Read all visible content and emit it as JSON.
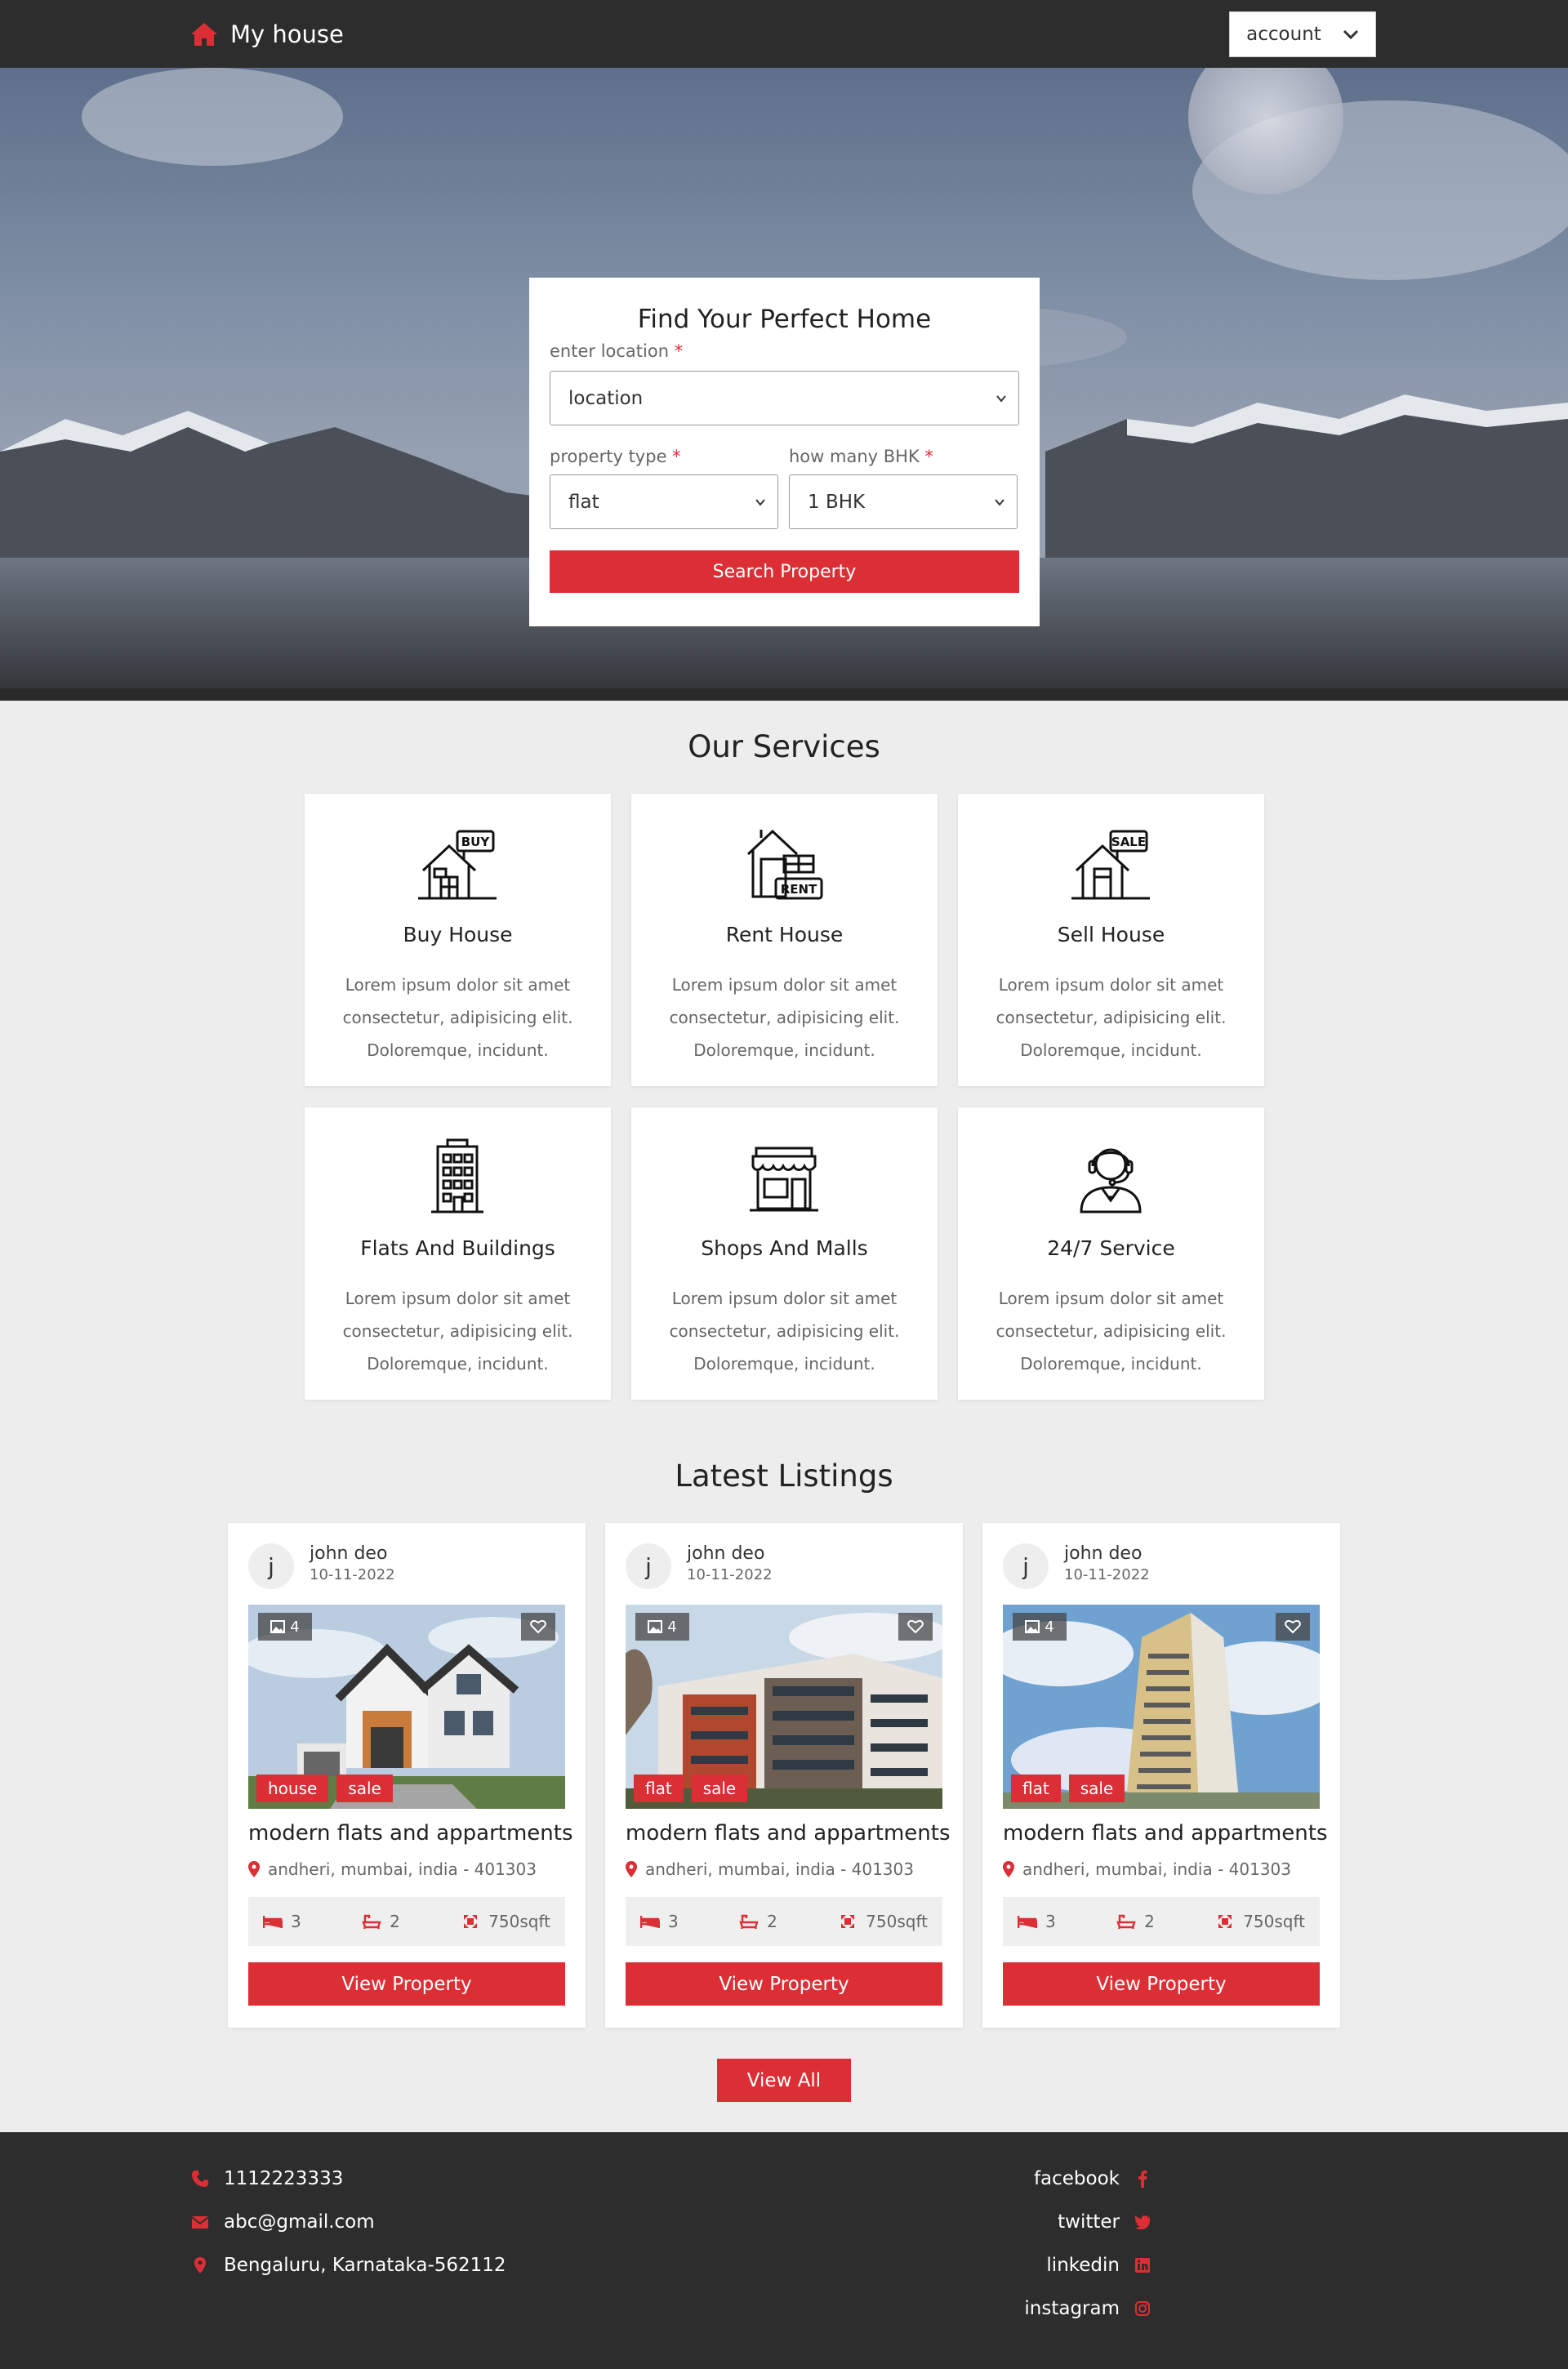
{
  "header": {
    "logo_text": "My house",
    "account_label": "account"
  },
  "search": {
    "title": "Find Your Perfect Home",
    "location_label": "enter location",
    "location_value": "location",
    "type_label": "property type",
    "type_value": "flat",
    "bhk_label": "how many BHK",
    "bhk_value": "1 BHK",
    "required_mark": "*",
    "button": "Search Property"
  },
  "services": {
    "title": "Our Services",
    "items": [
      {
        "title": "Buy House",
        "desc": "Lorem ipsum dolor sit amet consectetur, adipisicing elit. Doloremque, incidunt.",
        "icon": "buy-house-icon",
        "badge": "BUY"
      },
      {
        "title": "Rent House",
        "desc": "Lorem ipsum dolor sit amet consectetur, adipisicing elit. Doloremque, incidunt.",
        "icon": "rent-house-icon",
        "badge": "RENT"
      },
      {
        "title": "Sell House",
        "desc": "Lorem ipsum dolor sit amet consectetur, adipisicing elit. Doloremque, incidunt.",
        "icon": "sell-house-icon",
        "badge": "SALE"
      },
      {
        "title": "Flats And Buildings",
        "desc": "Lorem ipsum dolor sit amet consectetur, adipisicing elit. Doloremque, incidunt.",
        "icon": "building-icon"
      },
      {
        "title": "Shops And Malls",
        "desc": "Lorem ipsum dolor sit amet consectetur, adipisicing elit. Doloremque, incidunt.",
        "icon": "shop-icon"
      },
      {
        "title": "24/7 Service",
        "desc": "Lorem ipsum dolor sit amet consectetur, adipisicing elit. Doloremque, incidunt.",
        "icon": "support-agent-icon"
      }
    ]
  },
  "listings": {
    "title": "Latest Listings",
    "items": [
      {
        "avatar": "j",
        "author": "john deo",
        "date": "10-11-2022",
        "image_count": "4",
        "tags": [
          "house",
          "sale"
        ],
        "title": "modern flats and appartments",
        "location": "andheri, mumbai, india - 401303",
        "beds": "3",
        "baths": "2",
        "area": "750sqft",
        "button": "View Property"
      },
      {
        "avatar": "j",
        "author": "john deo",
        "date": "10-11-2022",
        "image_count": "4",
        "tags": [
          "flat",
          "sale"
        ],
        "title": "modern flats and appartments",
        "location": "andheri, mumbai, india - 401303",
        "beds": "3",
        "baths": "2",
        "area": "750sqft",
        "button": "View Property"
      },
      {
        "avatar": "j",
        "author": "john deo",
        "date": "10-11-2022",
        "image_count": "4",
        "tags": [
          "flat",
          "sale"
        ],
        "title": "modern flats and appartments",
        "location": "andheri, mumbai, india - 401303",
        "beds": "3",
        "baths": "2",
        "area": "750sqft",
        "button": "View Property"
      }
    ],
    "view_all": "View All"
  },
  "footer": {
    "phone": "1112223333",
    "email": "abc@gmail.com",
    "address": "Bengaluru, Karnataka-562112",
    "social": [
      "facebook",
      "twitter",
      "linkedin",
      "instagram"
    ]
  },
  "colors": {
    "accent": "#dc2f35",
    "dark": "#2d2d2d",
    "page_bg": "#ededed"
  }
}
